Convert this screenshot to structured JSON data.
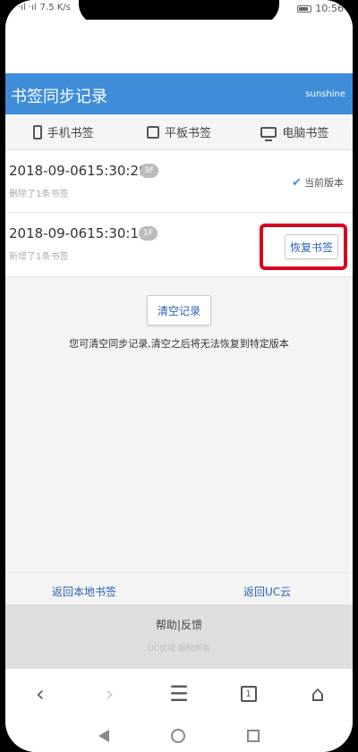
{
  "statusbar": {
    "signal_left": "·ıl ·ıl",
    "speed": "7.5 K/s",
    "time": "10:56"
  },
  "header": {
    "title": "书签同步记录",
    "user": "sunshine"
  },
  "tabs": [
    {
      "label": "手机书签",
      "icon": "phone-icon"
    },
    {
      "label": "平板书签",
      "icon": "tablet-icon"
    },
    {
      "label": "电脑书签",
      "icon": "monitor-icon"
    }
  ],
  "records": [
    {
      "time": "2018-09-0615:30:29",
      "badge": "3F",
      "desc": "删除了1条书签",
      "status": "当前版本"
    },
    {
      "time": "2018-09-0615:30:14",
      "badge": "1F",
      "desc": "新增了1条书签",
      "action": "恢复书签"
    }
  ],
  "clear_button": "清空记录",
  "hint": "您可清空同步记录,清空之后将无法恢复到特定版本",
  "footer": {
    "back_local": "返回本地书签",
    "back_cloud": "返回UC云",
    "help": "帮助|反馈",
    "copyright": "UC优视 版权所有"
  },
  "browser_bar": {
    "back": "‹",
    "forward": "›",
    "menu": "☰",
    "pages": "1",
    "home": "⌂"
  },
  "colors": {
    "header_bg": "#3f8dd8",
    "highlight_border": "#d9001b",
    "link": "#2c5fb5"
  }
}
